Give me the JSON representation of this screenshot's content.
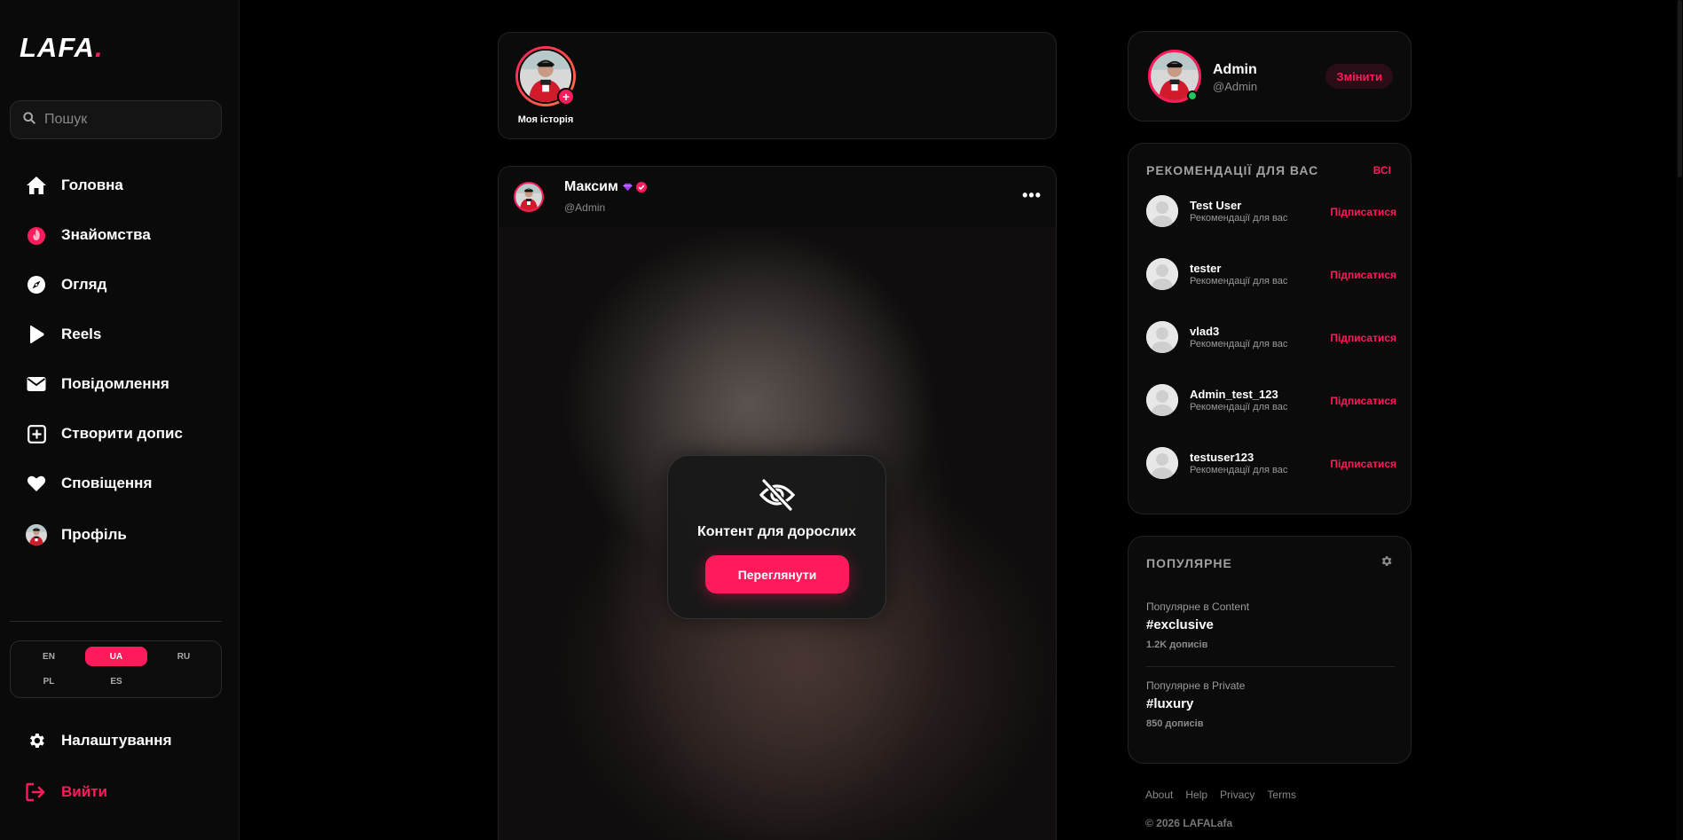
{
  "app": {
    "logo": "LAFA",
    "logo_dot": ".",
    "accent": "#ff1a5c"
  },
  "search": {
    "placeholder": "Пошук"
  },
  "nav": {
    "items": [
      {
        "label": "Головна",
        "icon": "home-icon"
      },
      {
        "label": "Знайомства",
        "icon": "flame-icon"
      },
      {
        "label": "Огляд",
        "icon": "compass-icon"
      },
      {
        "label": "Reels",
        "icon": "play-icon"
      },
      {
        "label": "Повідомлення",
        "icon": "mail-icon"
      },
      {
        "label": "Створити допис",
        "icon": "plus-square-icon"
      },
      {
        "label": "Сповіщення",
        "icon": "heart-icon"
      },
      {
        "label": "Профіль",
        "icon": "avatar-icon"
      }
    ],
    "settings": "Налаштування",
    "logout": "Вийти"
  },
  "languages": {
    "options": [
      "EN",
      "UA",
      "RU",
      "PL",
      "ES"
    ],
    "selected": "UA"
  },
  "stories": {
    "my_story": "Моя історія"
  },
  "post": {
    "author": "Максим",
    "handle": "@Admin",
    "more": "•••",
    "adult_title": "Контент для дорослих",
    "adult_button": "Переглянути"
  },
  "profile": {
    "name": "Admin",
    "handle": "@Admin",
    "change": "Змінити"
  },
  "recommendations": {
    "title": "РЕКОМЕНДАЦІЇ ДЛЯ ВАС",
    "all": "ВСІ",
    "users": [
      {
        "name": "Test User",
        "sub": "Рекомендації для вас",
        "follow": "Підписатися"
      },
      {
        "name": "tester",
        "sub": "Рекомендації для вас",
        "follow": "Підписатися"
      },
      {
        "name": "vlad3",
        "sub": "Рекомендації для вас",
        "follow": "Підписатися"
      },
      {
        "name": "Admin_test_123",
        "sub": "Рекомендації для вас",
        "follow": "Підписатися"
      },
      {
        "name": "testuser123",
        "sub": "Рекомендації для вас",
        "follow": "Підписатися"
      }
    ]
  },
  "popular": {
    "title": "ПОПУЛЯРНЕ",
    "items": [
      {
        "category": "Популярне в Content",
        "tag": "#exclusive",
        "count": "1.2K дописів"
      },
      {
        "category": "Популярне в Private",
        "tag": "#luxury",
        "count": "850 дописів"
      }
    ]
  },
  "footer": {
    "links": [
      "About",
      "Help",
      "Privacy",
      "Terms"
    ],
    "copyright": "© 2026 LAFALafa"
  }
}
